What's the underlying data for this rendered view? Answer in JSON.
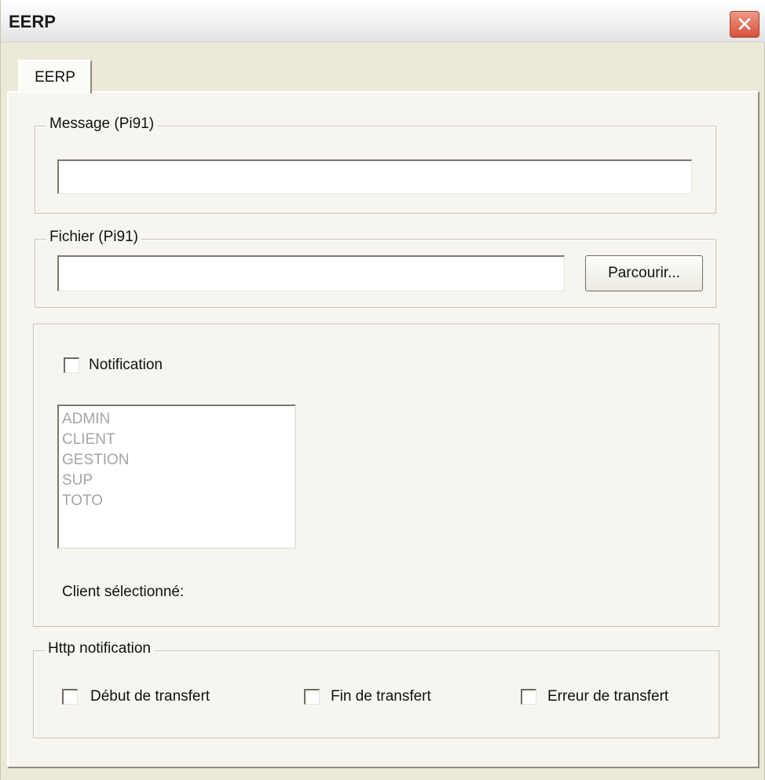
{
  "window": {
    "title": "EERP",
    "close_glyph": "✕"
  },
  "tabs": [
    {
      "label": "EERP"
    }
  ],
  "message_group": {
    "legend": "Message (Pi91)",
    "value": "",
    "placeholder": ""
  },
  "file_group": {
    "legend": "Fichier (Pi91)",
    "value": "",
    "placeholder": "",
    "browse_label": "Parcourir..."
  },
  "notification_group": {
    "checkbox_label": "Notification",
    "checked": false,
    "clients": [
      "ADMIN",
      "CLIENT",
      "GESTION",
      "SUP",
      "TOTO"
    ],
    "selected_client_label": "Client sélectionné:"
  },
  "http_group": {
    "legend": "Http notification",
    "options": [
      {
        "label": "Début de transfert",
        "checked": false
      },
      {
        "label": "Fin de transfert",
        "checked": false
      },
      {
        "label": "Erreur de transfert",
        "checked": false
      }
    ]
  },
  "colors": {
    "window_bg": "#ece9d8",
    "panel_bg": "#f6f5f0",
    "close_red": "#d5503a",
    "disabled_text": "#a5a5a5"
  },
  "icons": {
    "close": "close-icon",
    "checkbox": "checkbox-icon"
  }
}
